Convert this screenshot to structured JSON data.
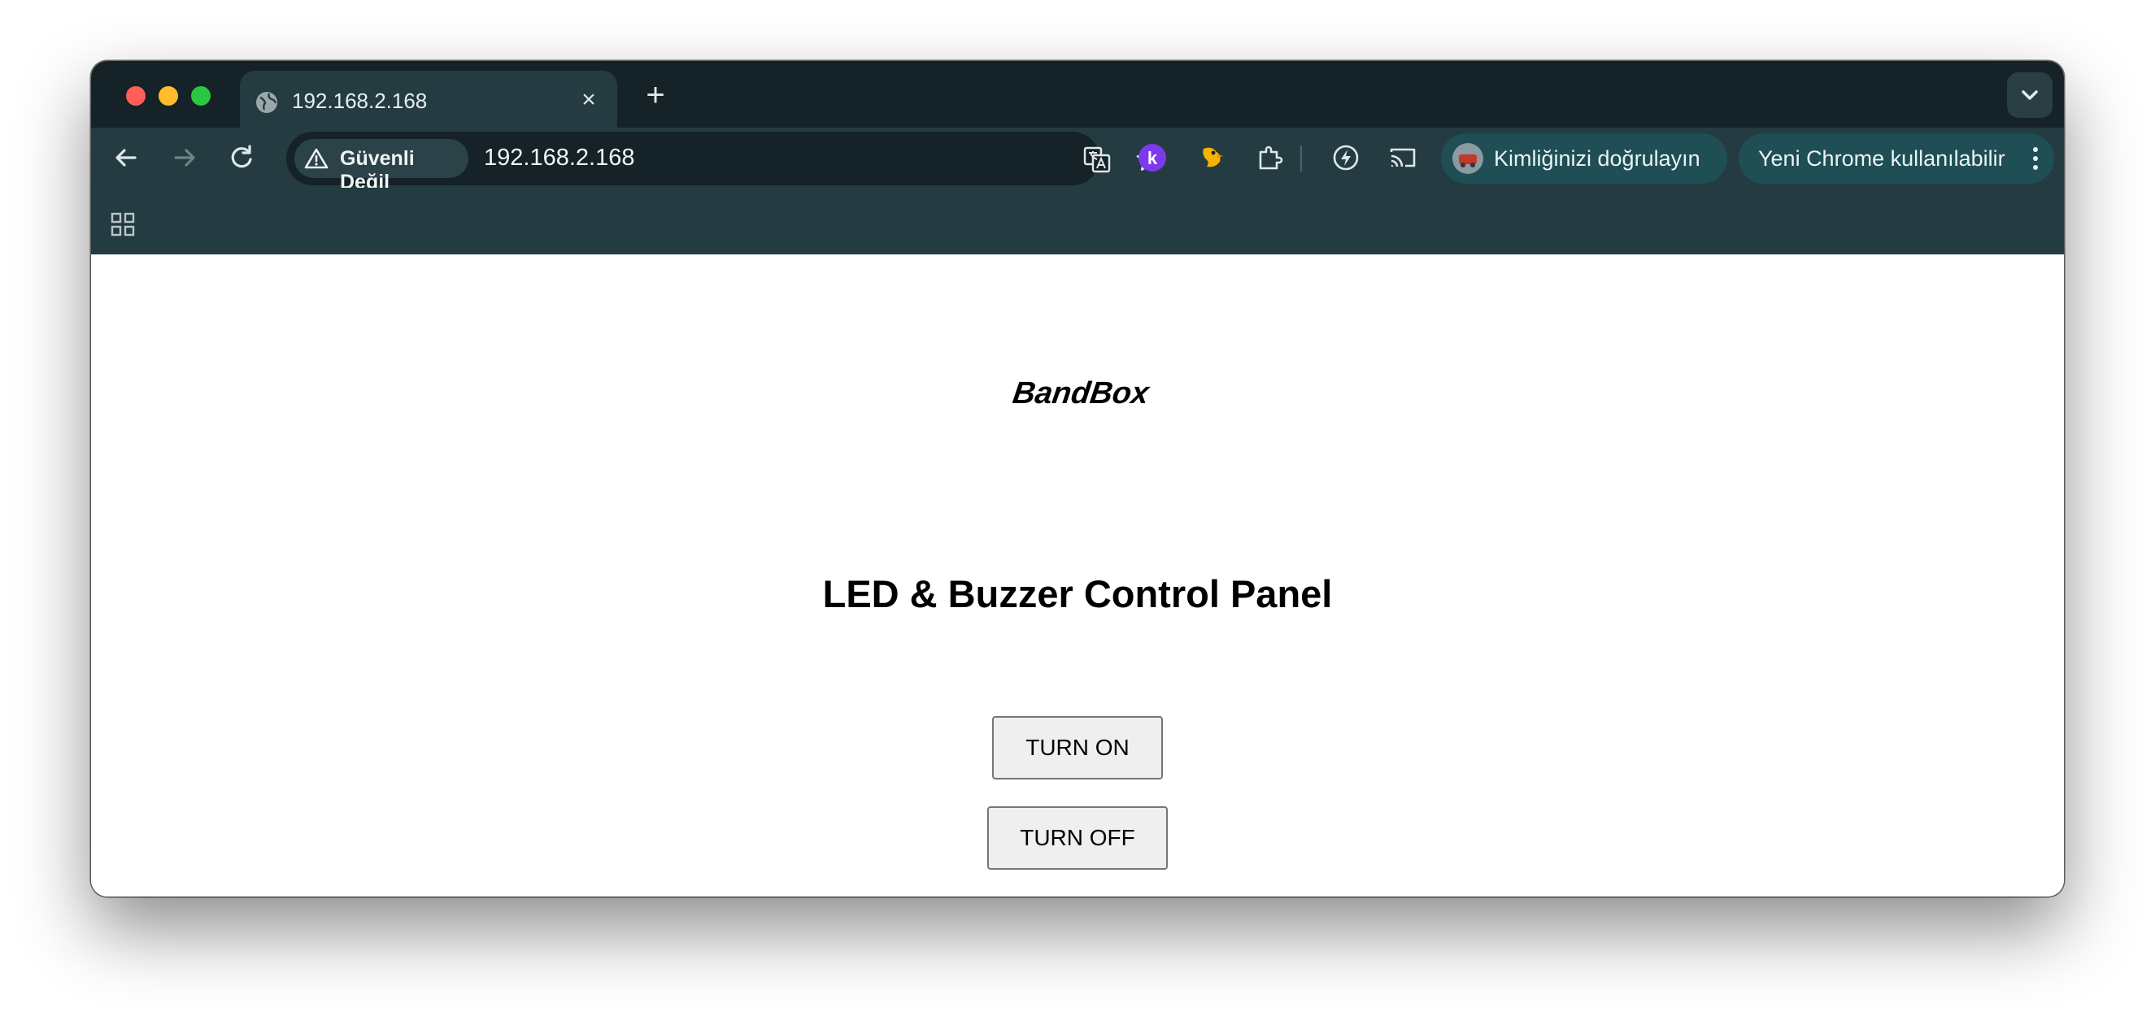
{
  "tab": {
    "title": "192.168.2.168",
    "close_label": "×",
    "new_tab_label": "+"
  },
  "omnibox": {
    "security_label": "Güvenli Değil",
    "url": "192.168.2.168"
  },
  "toolbar": {
    "profile_chip_label": "Kimliğinizi doğrulayın",
    "update_chip_label": "Yeni Chrome kullanılabilir",
    "extension_k_letter": "k"
  },
  "page": {
    "logo_text": "BandBox",
    "title": "LED & Buzzer Control Panel",
    "turn_on_label": "TURN ON",
    "turn_off_label": "TURN OFF"
  },
  "colors": {
    "tabstrip": "#152227",
    "toolbar": "#253b42",
    "chip": "#1f4e55",
    "extension_k": "#7c3aed"
  },
  "icons": {
    "tab_favicon": "globe-icon",
    "security": "warning-triangle-icon",
    "translate": "translate-icon",
    "bookmark": "star-icon",
    "extensions": [
      "k-extension-icon",
      "bird-extension-icon",
      "puzzle-icon"
    ],
    "performance": "energy-saver-icon",
    "cast": "cast-icon",
    "apps": "apps-grid-icon"
  }
}
